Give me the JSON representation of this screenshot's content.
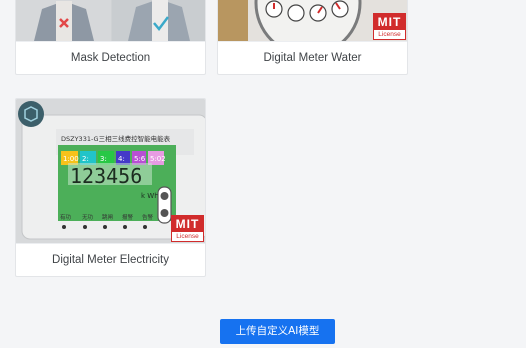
{
  "models": [
    {
      "title": "Mask Detection",
      "image_icon": "mask-detection-photo"
    },
    {
      "title": "Digital Meter Water",
      "image_icon": "water-meter-photo",
      "license_badge": {
        "brand": "MIT",
        "text": "License"
      }
    },
    {
      "title": "Digital Meter Electricity",
      "image_icon": "electric-meter-photo",
      "license_badge": {
        "brand": "MIT",
        "text": "License"
      },
      "meter": {
        "model_label": "DSZY331-G三相三线费控智能电能表",
        "reading": "123456",
        "unit": "k Wh",
        "segments": [
          "1:00",
          "2:",
          "3:",
          "4:",
          "5:6",
          "5:02"
        ],
        "button_labels": [
          "有功",
          "无功",
          "跳闸",
          "报警",
          "告警"
        ]
      }
    }
  ],
  "actions": {
    "upload_label": "上传自定义AI模型"
  },
  "colors": {
    "primary": "#1672f0",
    "license_red": "#d12c2c"
  }
}
